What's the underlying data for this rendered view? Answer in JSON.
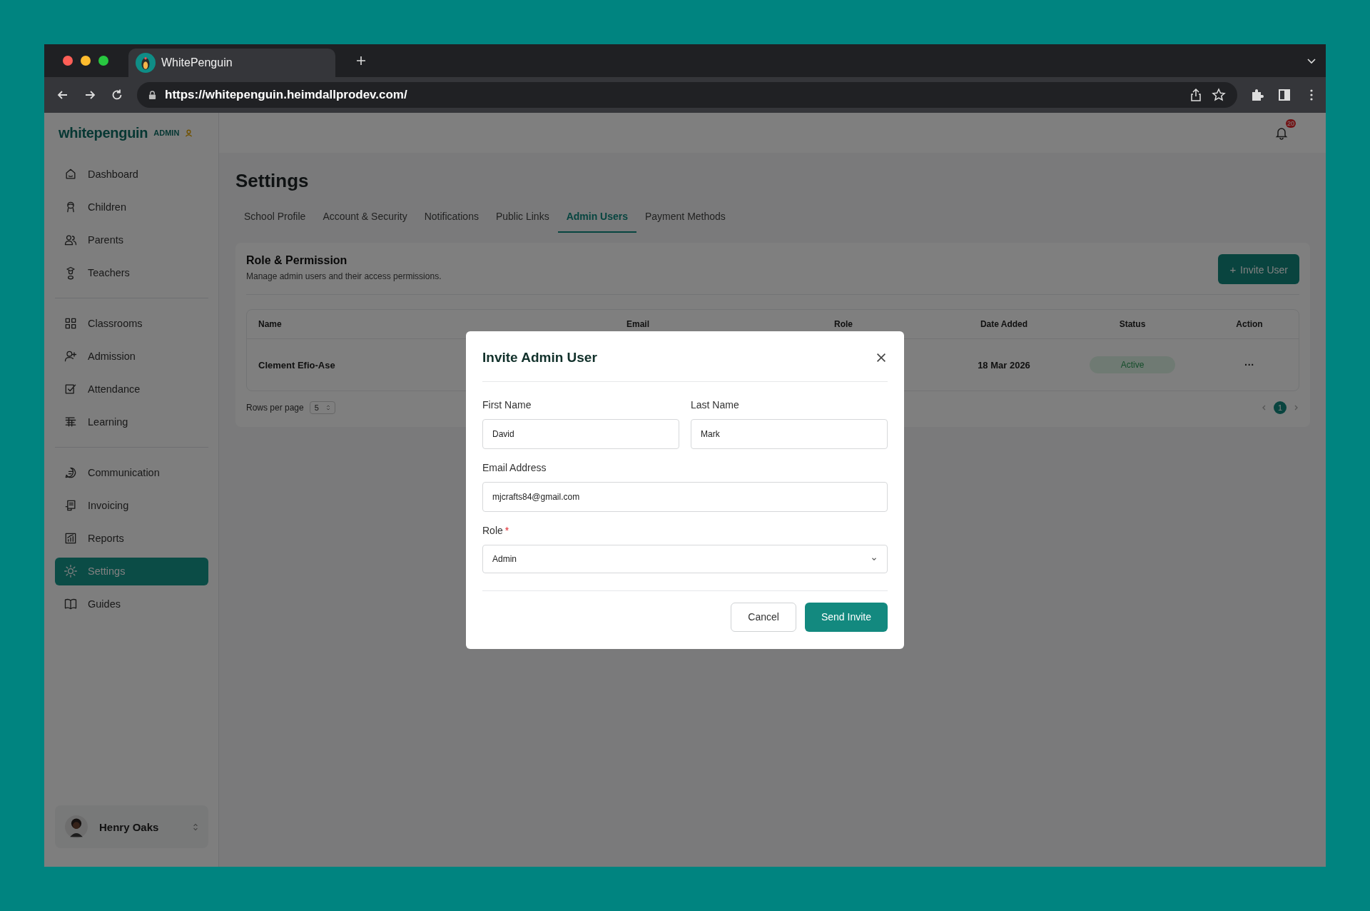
{
  "browser": {
    "tab_title": "WhitePenguin",
    "url": "https://whitepenguin.heimdallprodev.com/"
  },
  "brand": {
    "name": "whitepenguin",
    "badge": "ADMIN"
  },
  "sidebar": {
    "groups": [
      [
        {
          "label": "Dashboard",
          "selected": false
        },
        {
          "label": "Children",
          "selected": false
        },
        {
          "label": "Parents",
          "selected": false
        },
        {
          "label": "Teachers",
          "selected": false
        }
      ],
      [
        {
          "label": "Classrooms",
          "selected": false
        },
        {
          "label": "Admission",
          "selected": false
        },
        {
          "label": "Attendance",
          "selected": false
        },
        {
          "label": "Learning",
          "selected": false
        }
      ],
      [
        {
          "label": "Communication",
          "selected": false
        },
        {
          "label": "Invoicing",
          "selected": false
        },
        {
          "label": "Reports",
          "selected": false
        },
        {
          "label": "Settings",
          "selected": true
        },
        {
          "label": "Guides",
          "selected": false
        }
      ]
    ]
  },
  "user": {
    "name": "Henry Oaks"
  },
  "notifications": {
    "count": "20"
  },
  "page": {
    "title": "Settings",
    "tabs": [
      {
        "label": "School Profile",
        "selected": false
      },
      {
        "label": "Account & Security",
        "selected": false
      },
      {
        "label": "Notifications",
        "selected": false
      },
      {
        "label": "Public Links",
        "selected": false
      },
      {
        "label": "Admin Users",
        "selected": true
      },
      {
        "label": "Payment Methods",
        "selected": false
      }
    ]
  },
  "card": {
    "title": "Role & Permission",
    "subtitle": "Manage admin users and their access permissions.",
    "invite_button": "Invite User",
    "invite_icon": "+"
  },
  "table": {
    "columns": [
      "Name",
      "Email",
      "Role",
      "Date Added",
      "Status",
      "Action"
    ],
    "rows": [
      {
        "name": "Clement Efio-Ase",
        "date_added": "18 Mar 2026",
        "status": "Active",
        "action": "···"
      }
    ]
  },
  "pagination": {
    "rows_label": "Rows per page",
    "rows_value": "5",
    "pages": [
      {
        "label": "1",
        "selected": true
      }
    ]
  },
  "modal": {
    "title": "Invite Admin User",
    "first_name": {
      "label": "First Name",
      "value": "David"
    },
    "last_name": {
      "label": "Last Name",
      "value": "Mark"
    },
    "email": {
      "label": "Email Address",
      "value": "mjcrafts84@gmail.com"
    },
    "role": {
      "label": "Role",
      "required_mark": "*",
      "value": "Admin"
    },
    "cancel": "Cancel",
    "submit": "Send Invite"
  }
}
